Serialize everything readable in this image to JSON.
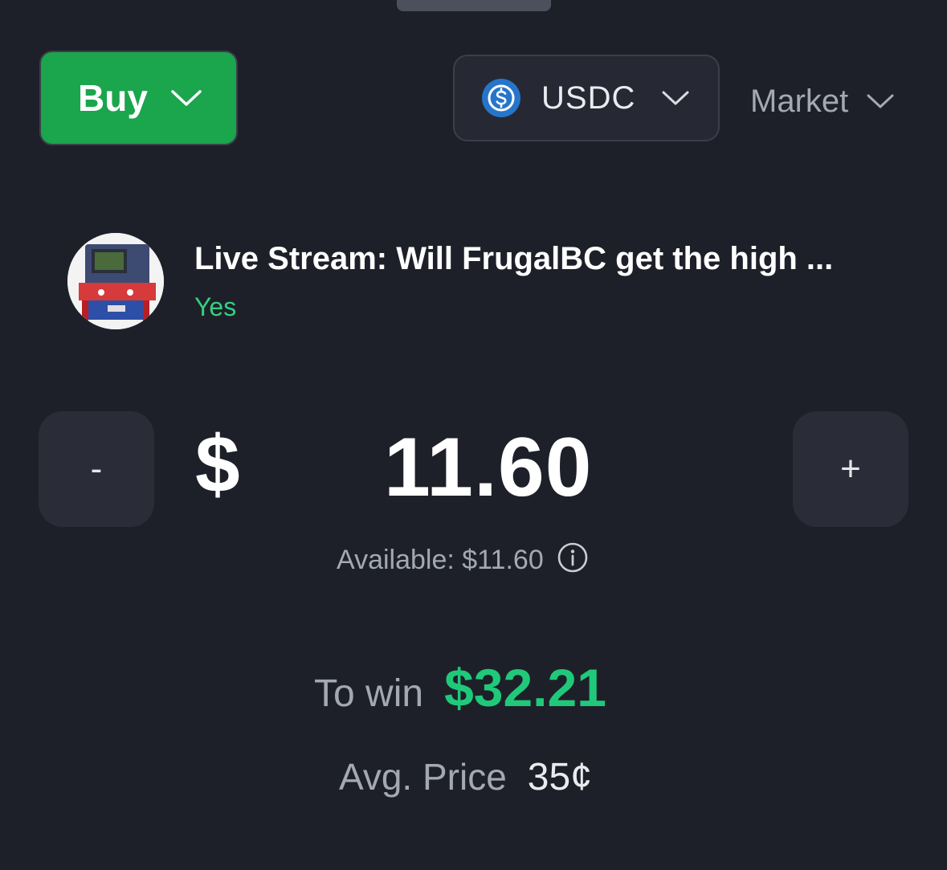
{
  "trade_panel": {
    "side": {
      "label": "Buy",
      "color": "#1ba54d"
    },
    "currency": {
      "label": "USDC",
      "icon": "usdc-coin-icon"
    },
    "order_type": {
      "label": "Market"
    }
  },
  "market": {
    "title": "Live Stream: Will FrugalBC get the high ...",
    "outcome": "Yes",
    "outcome_color": "#35d07f",
    "thumbnail": "arcade-cabinet-thumbnail"
  },
  "amount": {
    "currency_symbol": "$",
    "value": "11.60",
    "decrement_label": "-",
    "increment_label": "+",
    "available_text": "Available: $11.60",
    "info_icon": "info-icon"
  },
  "summary": {
    "to_win_label": "To win",
    "to_win_value": "$32.21",
    "to_win_color": "#20c97a",
    "avg_price_label": "Avg. Price",
    "avg_price_value": "35¢"
  }
}
